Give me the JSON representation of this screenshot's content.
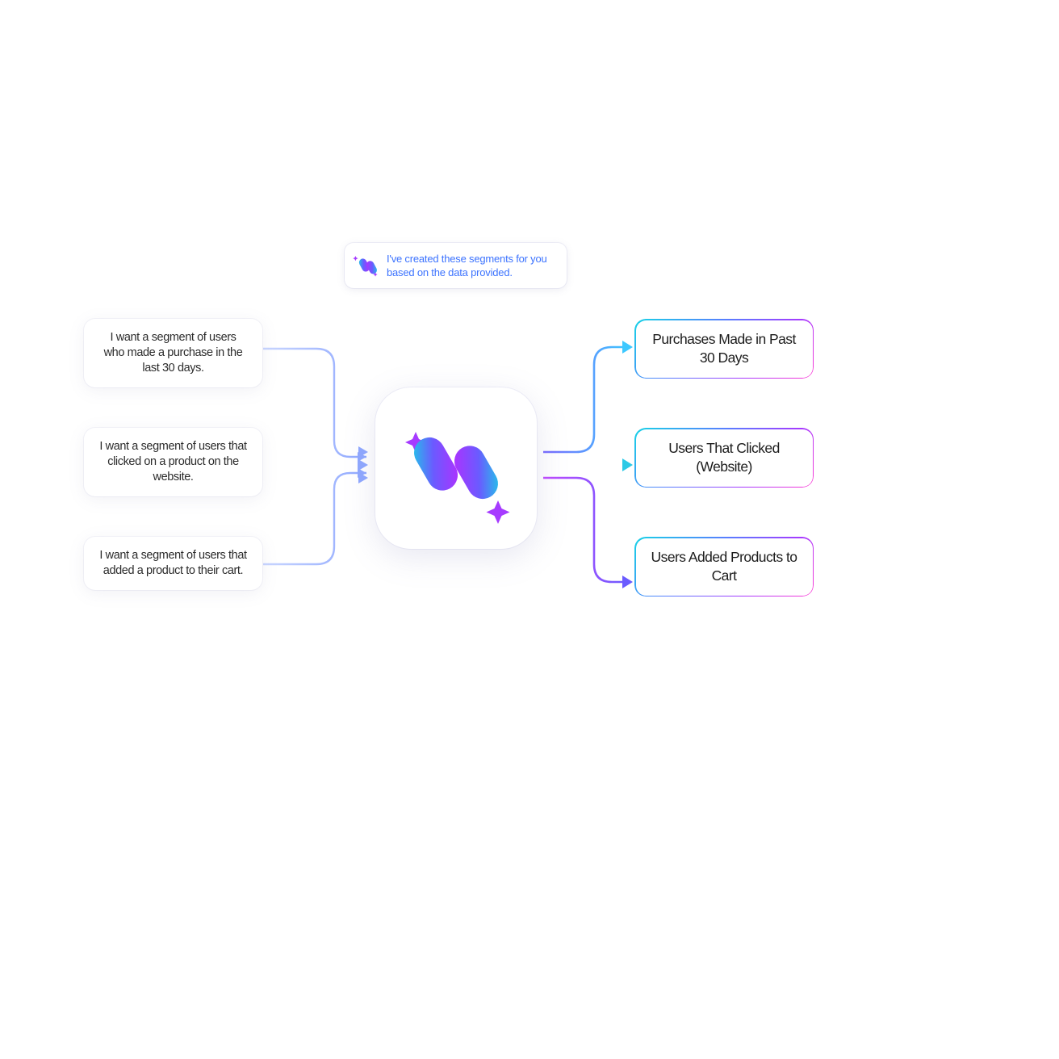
{
  "assistant": {
    "message": "I've created these segments for you based on the data provided."
  },
  "prompts": [
    "I want a segment of users who made a purchase in the last 30 days.",
    "I want a segment of users that clicked on a product on the website.",
    "I want a segment of users that added a product to their cart."
  ],
  "results": [
    "Purchases Made in Past 30 Days",
    "Users That Clicked (Website)",
    "Users Added Products to Cart"
  ],
  "colors": {
    "blue_text": "#3c73ff",
    "grad_cyan": "#17d3e6",
    "grad_blue": "#5b7bff",
    "grad_purple": "#a63bff",
    "grad_pink": "#ff3bd4"
  },
  "icons": {
    "brand_logo": "brand-logo-icon",
    "sparkle": "sparkle-icon"
  }
}
